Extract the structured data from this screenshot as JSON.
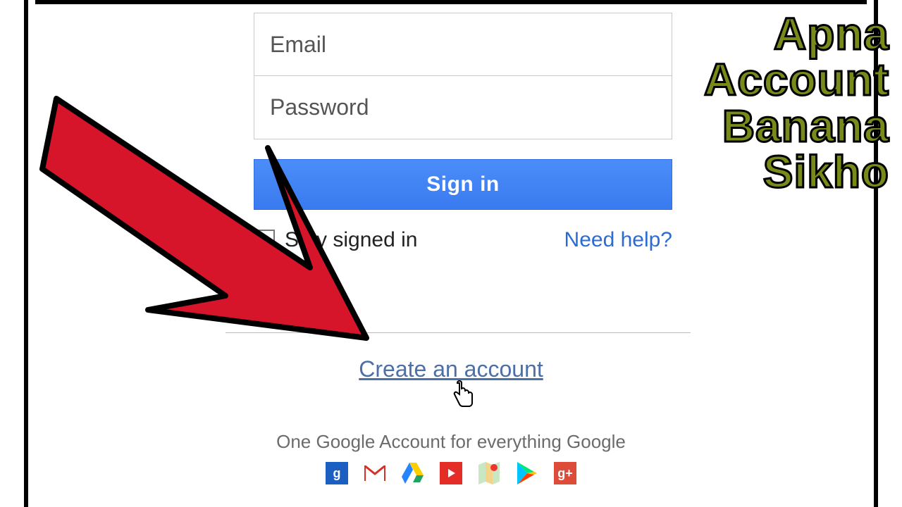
{
  "form": {
    "email_placeholder": "Email",
    "password_placeholder": "Password",
    "signin_label": "Sign in",
    "stay_signed_in_label": "Stay signed in",
    "need_help_label": "Need help?"
  },
  "create_account_label": "Create an account",
  "tagline": "One Google Account for everything Google",
  "overlay": {
    "line1": "Apna",
    "line2": "Account",
    "line3": "Banana",
    "line4": "Sikho"
  },
  "product_icons": [
    "search",
    "mail",
    "drive",
    "youtube",
    "maps",
    "play",
    "plus"
  ]
}
